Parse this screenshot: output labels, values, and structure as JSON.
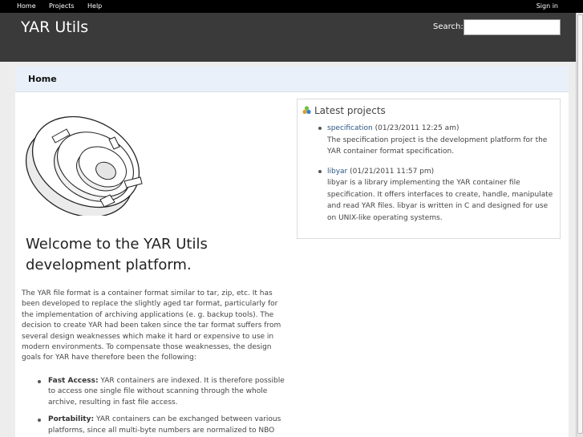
{
  "top_menu": {
    "items": [
      "Home",
      "Projects",
      "Help"
    ],
    "sign_in": "Sign in"
  },
  "header": {
    "title": "YAR Utils",
    "search_label": "Search:",
    "search_value": ""
  },
  "breadcrumb": {
    "title": "Home"
  },
  "welcome": {
    "heading": "Welcome to the YAR Utils development platform."
  },
  "intro": "The YAR file format is a container format similar to tar, zip, etc. It has been developed to replace the slightly aged tar format, particularly for the implementation of archiving applications (e. g. backup tools). The decision to create YAR had been taken since the tar format suffers from several design weaknesses which make it hard or expensive to use in modern environments. To compensate those weaknesses, the design goals for YAR have therefore been the following:",
  "features": [
    {
      "title": "Fast Access:",
      "text": "YAR containers are indexed. It is therefore possible to access one single file without scanning through the whole archive, resulting in fast file access."
    },
    {
      "title": "Portability:",
      "text": "YAR containers can be exchanged between various platforms, since all multi-byte numbers are normalized to NBO (big"
    }
  ],
  "latest_projects": {
    "heading": "Latest projects",
    "icon": "projects-icon",
    "items": [
      {
        "name": "specification",
        "date": "(01/23/2011 12:25 am)",
        "description": "The specification project is the development platform for the YAR container format specification."
      },
      {
        "name": "libyar",
        "date": "(01/21/2011 11:57 pm)",
        "description": "libyar is a library implementing the YAR container file specification. It offers interfaces to create, handle, manipulate and read YAR files. libyar is written in C and designed for use on UNIX-like operating systems."
      }
    ]
  },
  "colors": {
    "top_menu_bg": "#000000",
    "header_bg": "#3a3a3a",
    "breadcrumb_bg": "#e9f0fa",
    "link": "#2a5685"
  }
}
